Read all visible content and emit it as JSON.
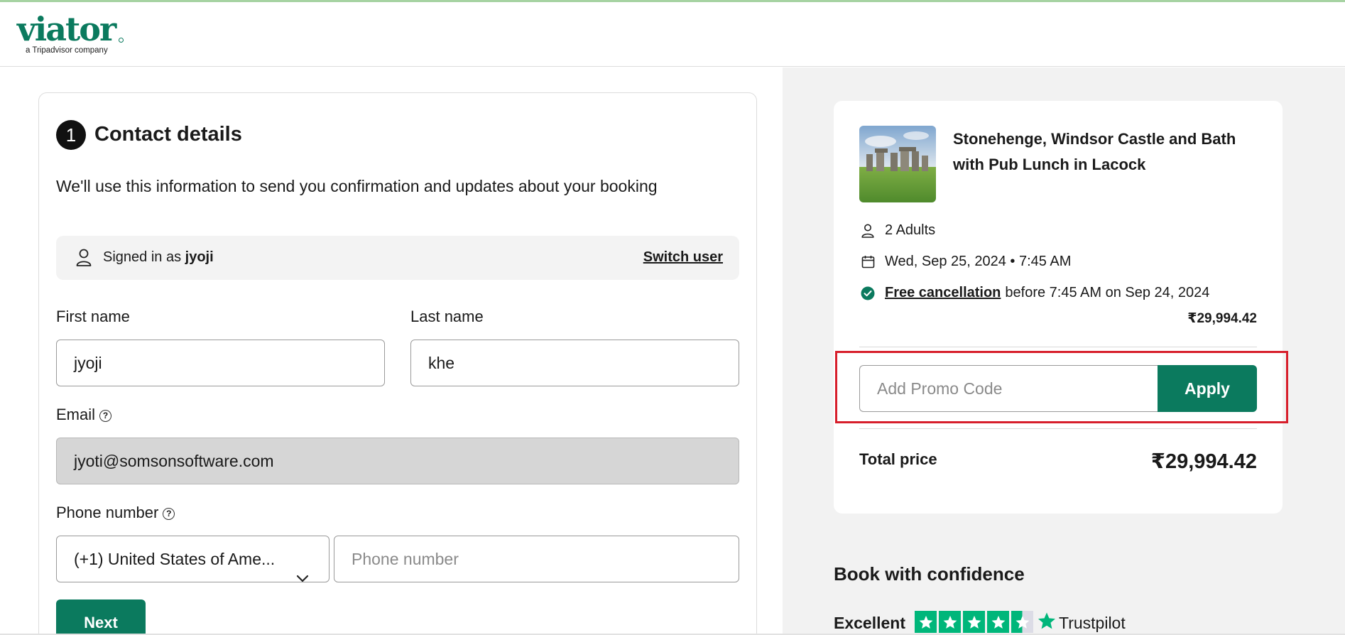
{
  "brand": {
    "name": "viator",
    "tagline": "a Tripadvisor company",
    "color": "#0b7a5e"
  },
  "contact": {
    "step_number": "1",
    "title": "Contact details",
    "description": "We'll use this information to send you confirmation and updates about your booking",
    "signed_in_prefix": "Signed in as",
    "signed_in_user": "jyoji",
    "switch_user_label": "Switch user",
    "first_name_label": "First name",
    "first_name_value": "jyoji",
    "last_name_label": "Last name",
    "last_name_value": "khe",
    "email_label": "Email",
    "email_value": "jyoti@somsonsoftware.com",
    "phone_label": "Phone number",
    "country_code_value": "(+1) United States of Ame...",
    "phone_placeholder": "Phone number",
    "next_label": "Next"
  },
  "summary": {
    "tour_title": "Stonehenge, Windsor Castle and Bath with Pub Lunch in Lacock",
    "travelers": "2 Adults",
    "datetime": "Wed, Sep 25, 2024 • 7:45 AM",
    "free_cancellation_label": "Free cancellation",
    "cancellation_detail": "before 7:45 AM on Sep 24, 2024",
    "subtotal": "₹29,994.42",
    "promo_placeholder": "Add Promo Code",
    "apply_label": "Apply",
    "total_label": "Total price",
    "total_value": "₹29,994.42"
  },
  "confidence": {
    "heading": "Book with confidence",
    "rating_label": "Excellent",
    "rating_stars": 4.5,
    "trustpilot_label": "Trustpilot"
  },
  "icons": {
    "user": "user-icon",
    "calendar": "calendar-icon",
    "check": "check-circle-icon",
    "question": "question-circle-icon",
    "chevron": "chevron-down-icon",
    "star": "star-icon"
  },
  "colors": {
    "accent": "#0b7a5e",
    "highlight": "#d71e2b",
    "trustpilot": "#00b67a"
  }
}
